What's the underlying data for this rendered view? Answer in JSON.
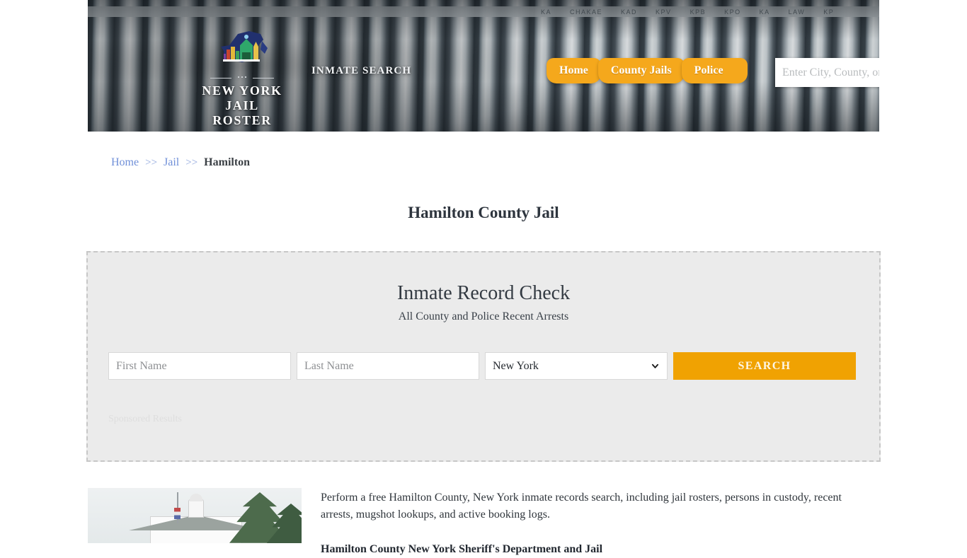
{
  "site": {
    "logo_line1": "NEW YORK",
    "logo_line2": "JAIL ROSTER",
    "logo_mark_name": "new-york-state-logo",
    "tagline": "INMATE SEARCH"
  },
  "header": {
    "nav": [
      {
        "label": "Home",
        "name": "nav-tab-home"
      },
      {
        "label": "County Jails",
        "name": "nav-tab-county-jails"
      },
      {
        "label": "Police",
        "name": "nav-tab-police"
      }
    ],
    "search": {
      "placeholder": "Enter City, County, or Facility Name",
      "value": "",
      "icon": "search-icon"
    },
    "rail_labels": [
      "KA",
      "CHAKAE",
      "KAD",
      "KPV",
      "KPB",
      "KPO",
      "KA",
      "LAW",
      "KP"
    ]
  },
  "breadcrumb": {
    "items": [
      {
        "label": "Home",
        "link": true
      },
      {
        "label": "Jail",
        "link": true
      },
      {
        "label": "Hamilton",
        "link": false
      }
    ],
    "separator": ">>"
  },
  "page": {
    "title": "Hamilton County Jail"
  },
  "record_check": {
    "title": "Inmate Record Check",
    "subtitle": "All County and Police Recent Arrests",
    "first_name_placeholder": "First Name",
    "first_name_value": "",
    "last_name_placeholder": "Last Name",
    "last_name_value": "",
    "state_selected": "New York",
    "state_options": [
      "New York"
    ],
    "search_button": "SEARCH",
    "sponsored_label": "Sponsored Results",
    "button_color": "#f0a202"
  },
  "content": {
    "thumbnail_name": "hamilton-county-courthouse-photo",
    "paragraph": "Perform a free Hamilton County, New York inmate records search, including jail rosters, persons in custody, recent arrests, mugshot lookups, and active booking logs.",
    "subheading": "Hamilton County New York Sheriff's Department and Jail"
  },
  "colors": {
    "accent_orange": "#f5a81c",
    "link_blue": "#6f8fd8",
    "panel_bg": "#ebebeb"
  }
}
